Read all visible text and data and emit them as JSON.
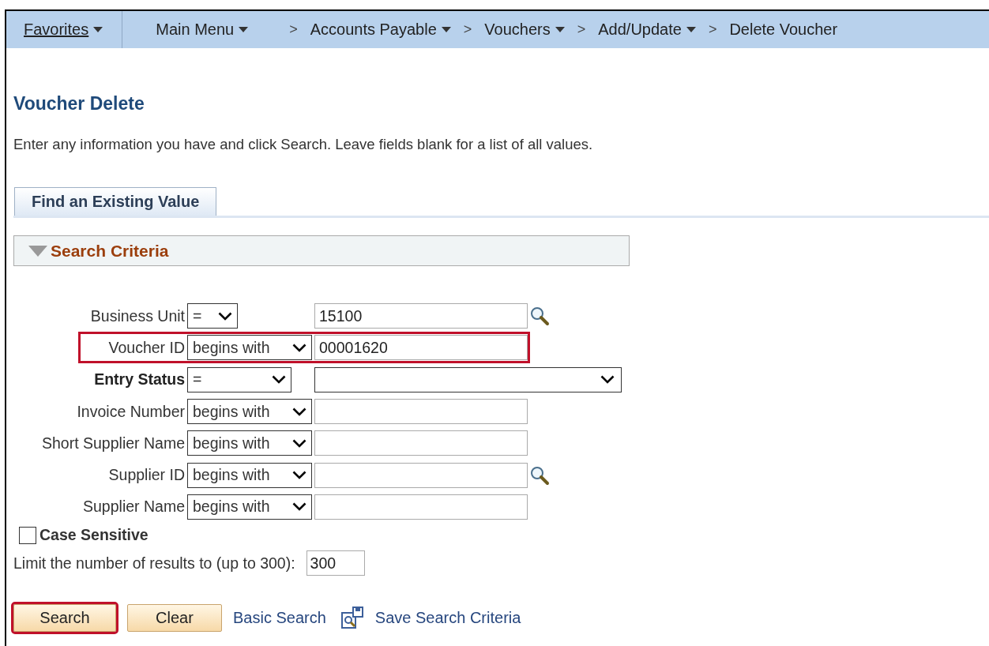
{
  "nav": {
    "favorites": "Favorites",
    "main_menu": "Main Menu",
    "breadcrumbs": [
      {
        "separator": ">",
        "label": "Accounts Payable",
        "menu": true
      },
      {
        "separator": ">",
        "label": "Vouchers",
        "menu": true
      },
      {
        "separator": ">",
        "label": "Add/Update",
        "menu": true
      },
      {
        "separator": ">",
        "label": "Delete Voucher",
        "menu": false
      }
    ]
  },
  "page": {
    "title": "Voucher Delete",
    "instructions": "Enter any information you have and click Search. Leave fields blank for a list of all values."
  },
  "tabs": [
    {
      "label": "Find an Existing Value",
      "selected": true
    }
  ],
  "section": {
    "title": "Search Criteria",
    "expanded": true
  },
  "criteria": [
    {
      "label": "Business Unit",
      "required": false,
      "operator": "=",
      "kind": "text",
      "value": "15100",
      "lookup": true,
      "highlighted": false
    },
    {
      "label": "Voucher ID",
      "required": false,
      "operator": "begins with",
      "kind": "text",
      "value": "00001620",
      "lookup": false,
      "highlighted": true
    },
    {
      "label": "Entry Status",
      "required": true,
      "operator": "=",
      "kind": "dropdown",
      "lookup": false,
      "highlighted": false
    },
    {
      "label": "Invoice Number",
      "required": false,
      "operator": "begins with",
      "kind": "text",
      "lookup": false,
      "highlighted": false
    },
    {
      "label": "Short Supplier Name",
      "required": false,
      "operator": "begins with",
      "kind": "text",
      "lookup": false,
      "highlighted": false
    },
    {
      "label": "Supplier ID",
      "required": false,
      "operator": "begins with",
      "kind": "text",
      "lookup": true,
      "highlighted": false
    },
    {
      "label": "Supplier Name",
      "required": false,
      "operator": "begins with",
      "kind": "text",
      "lookup": false,
      "highlighted": false
    }
  ],
  "case_sensitive": {
    "label": "Case Sensitive",
    "checked": false
  },
  "limit": {
    "label": "Limit the number of results to (up to 300):",
    "value": "300"
  },
  "buttons": [
    {
      "label": "Search",
      "highlighted": true
    },
    {
      "label": "Clear",
      "highlighted": false
    }
  ],
  "links": [
    {
      "label": "Basic Search",
      "icon": false
    },
    {
      "label": "Save Search Criteria",
      "icon": true
    }
  ]
}
